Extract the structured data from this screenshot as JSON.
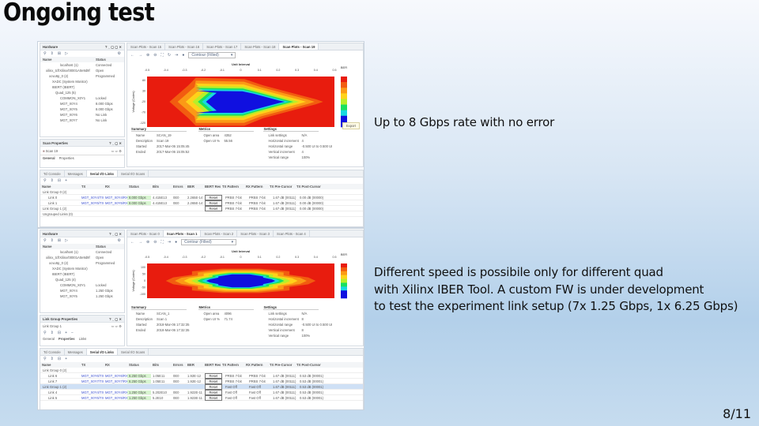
{
  "slide": {
    "title": "Ongoing test",
    "note1": "Up to 8 Gbps rate with no error",
    "note2_lines": [
      "Different speed is possibile only for different quad",
      "with Xilinx IBER Tool. A custom FW is under development",
      "to test the experiment link setup (7x 1.25 Gbps, 1x 6.25 Gbps)"
    ],
    "page": "8/11"
  },
  "shot1": {
    "hardware": {
      "title": "Hardware",
      "cols": [
        "Name",
        "Status"
      ],
      "rows": [
        {
          "name": "localhost (1)",
          "status": "Connected"
        },
        {
          "name": "xilinx_tcf/Xilinx/00001A0e9d9f",
          "status": "Open"
        },
        {
          "name": "xcvu9p_0 (2)",
          "status": "Programmed"
        },
        {
          "name": "XADC (System Monitor)",
          "status": ""
        },
        {
          "name": "IBERT (IBERT)",
          "status": ""
        },
        {
          "name": "Quad_125 (5)",
          "status": ""
        },
        {
          "name": "COMMON_X0Y1",
          "status": "Locked"
        },
        {
          "name": "MGT_X0Y4",
          "status": "8.000 Gbps"
        },
        {
          "name": "MGT_X0Y5",
          "status": "8.000 Gbps"
        },
        {
          "name": "MGT_X0Y6",
          "status": "No Link"
        },
        {
          "name": "MGT_X0Y7",
          "status": "No Link"
        }
      ]
    },
    "scan_props": {
      "title": "Scan Properties",
      "item": "Scan 19",
      "tabs": [
        "General",
        "Properties"
      ]
    },
    "plot_tabs": [
      "Scan Plots - Scan 15",
      "Scan Plots - Scan 16",
      "Scan Plots - Scan 17",
      "Scan Plots - Scan 18",
      "Scan Plots - Scan 19"
    ],
    "plot_mode": "Contour (Filled)",
    "plot": {
      "xlabel": "Unit Interval",
      "ylabel": "Voltage (Codes)",
      "legend": "BER",
      "xticks": [
        "-0.5",
        "-0.4",
        "-0.3",
        "-0.2",
        "-0.1",
        "0",
        "0.1",
        "0.2",
        "0.3",
        "0.4",
        "0.5"
      ],
      "yticks": [
        "80",
        "30",
        "-20",
        "-70",
        "-120"
      ]
    },
    "summary": {
      "title": "Summary",
      "rows": [
        [
          "Name",
          "SCAN_19"
        ],
        [
          "Description",
          "Scan 19"
        ],
        [
          "Started",
          "2017-Mar-06 15:05:45"
        ],
        [
          "Ended",
          "2017-Mar-06 15:05:52"
        ]
      ]
    },
    "metrics": {
      "title": "Metrics",
      "rows": [
        [
          "Open area",
          "4352"
        ],
        [
          "Open UI %",
          "55.56"
        ]
      ]
    },
    "settings": {
      "title": "Settings",
      "rows": [
        [
          "Link settings",
          "N/A"
        ],
        [
          "Horizontal increment",
          "4"
        ],
        [
          "Horizontal range",
          "-0.500 UI to 0.500 UI"
        ],
        [
          "Vertical increment",
          "4"
        ],
        [
          "Vertical range",
          "100%"
        ]
      ]
    },
    "export_label": "Export",
    "bottom_tabs": [
      "Tcl Console",
      "Messages",
      "Serial I/O Links",
      "Serial I/O Scans"
    ],
    "links": {
      "cols": [
        "Name",
        "TX",
        "RX",
        "Status",
        "Bits",
        "Errors",
        "BER",
        "BERT Reset",
        "TX Pattern",
        "RX Pattern",
        "TX Pre-Cursor",
        "TX Post-Cursor"
      ],
      "rows": [
        {
          "name": "Link Group 0 (2)",
          "group": true
        },
        {
          "name": "Link 0",
          "tx": "MGT_X0Y4/TX",
          "rx": "MGT_X0Y4/RX",
          "status": "8.000 Gbps",
          "bits": "4.415E13",
          "errors": "0E0",
          "ber": "2.265E-14",
          "reset": "Reset",
          "txp": "PRBS 7-bit",
          "rxp": "PRBS 7-bit",
          "pre": "1.67 dB (00111)",
          "post": "0.00 dB (00000)"
        },
        {
          "name": "Link 1",
          "tx": "MGT_X0Y5/TX",
          "rx": "MGT_X0Y5/RX",
          "status": "8.000 Gbps",
          "bits": "4.415E13",
          "errors": "0E0",
          "ber": "2.265E-14",
          "reset": "Reset",
          "txp": "PRBS 7-bit",
          "rxp": "PRBS 7-bit",
          "pre": "1.67 dB (00111)",
          "post": "0.00 dB (00000)"
        },
        {
          "name": "Link Group 1 (2)",
          "group": true,
          "reset": "Reset",
          "txp": "PRBS 7-bit",
          "rxp": "PRBS 7-bit",
          "pre": "1.67 dB (00111)",
          "post": "0.00 dB (00000)"
        },
        {
          "name": "Ungrouped Links (0)",
          "group": true
        }
      ]
    }
  },
  "shot2": {
    "hardware": {
      "title": "Hardware",
      "cols": [
        "Name",
        "Status"
      ],
      "rows": [
        {
          "name": "localhost (1)",
          "status": "Connected"
        },
        {
          "name": "xilinx_tcf/Xilinx/00001A0e9d9f",
          "status": "Open"
        },
        {
          "name": "xcvu9p_0 (2)",
          "status": "Programmed"
        },
        {
          "name": "XADC (System Monitor)",
          "status": ""
        },
        {
          "name": "IBERT (IBERT)",
          "status": ""
        },
        {
          "name": "Quad_125 (4)",
          "status": ""
        },
        {
          "name": "COMMON_X0Y1",
          "status": "Locked"
        },
        {
          "name": "MGT_X0Y4",
          "status": "1.250 Gbps"
        },
        {
          "name": "MGT_X0Y5",
          "status": "1.250 Gbps"
        }
      ]
    },
    "group_props": {
      "title": "Link Group Properties",
      "item": "Link Group 1",
      "tabs": [
        "General",
        "Properties",
        "Links"
      ]
    },
    "plot_tabs": [
      "Scan Plots - Scan 0",
      "Scan Plots - Scan 1",
      "Scan Plots - Scan 2",
      "Scan Plots - Scan 3",
      "Scan Plots - Scan 4"
    ],
    "plot_mode": "Contour (Filled)",
    "plot": {
      "xlabel": "Unit Interval",
      "ylabel": "Voltage (Codes)",
      "legend": "BER",
      "xticks": [
        "-0.5",
        "-0.4",
        "-0.3",
        "-0.2",
        "-0.1",
        "0",
        "0.1",
        "0.2",
        "0.3",
        "0.4",
        "0.5"
      ],
      "yticks": [
        "100",
        "50",
        "0",
        "-50",
        "-100"
      ]
    },
    "summary": {
      "title": "Summary",
      "rows": [
        [
          "Name",
          "SCAN_1"
        ],
        [
          "Description",
          "Scan 1"
        ],
        [
          "Started",
          "2018-Mar-06 17:32:35"
        ],
        [
          "Ended",
          "2018-Mar-06 17:32:35"
        ]
      ]
    },
    "metrics": {
      "title": "Metrics",
      "rows": [
        [
          "Open area",
          "4096"
        ],
        [
          "Open UI %",
          "71.74"
        ]
      ]
    },
    "settings": {
      "title": "Settings",
      "rows": [
        [
          "Link settings",
          "N/A"
        ],
        [
          "Horizontal increment",
          "8"
        ],
        [
          "Horizontal range",
          "-0.500 UI to 0.500 UI"
        ],
        [
          "Vertical increment",
          "8"
        ],
        [
          "Vertical range",
          "100%"
        ]
      ]
    },
    "bottom_tabs": [
      "Tcl Console",
      "Messages",
      "Serial I/O Links",
      "Serial I/O Scans"
    ],
    "links": {
      "cols": [
        "Name",
        "TX",
        "RX",
        "Status",
        "Bits",
        "Errors",
        "BER",
        "BERT Reset",
        "TX Pattern",
        "RX Pattern",
        "TX Pre-Cursor",
        "TX Post-Cursor"
      ],
      "rows": [
        {
          "name": "Link Group 0 (2)",
          "group": true
        },
        {
          "name": "Link 6",
          "tx": "MGT_X0Y6/TX",
          "rx": "MGT_X0Y6/RX",
          "status": "6.250 Gbps",
          "bits": "1.05E11",
          "errors": "0E0",
          "ber": "1.92E-12",
          "reset": "Reset",
          "txp": "PRBS 7-bit",
          "rxp": "PRBS 7-bit",
          "pre": "1.67 dB (00111)",
          "post": "0.53 dB (00001)"
        },
        {
          "name": "Link 7",
          "tx": "MGT_X0Y7/TX",
          "rx": "MGT_X0Y7/RX",
          "status": "6.250 Gbps",
          "bits": "1.05E11",
          "errors": "0E0",
          "ber": "1.92E-12",
          "reset": "Reset",
          "txp": "PRBS 7-bit",
          "rxp": "PRBS 7-bit",
          "pre": "1.67 dB (00111)",
          "post": "0.53 dB (00001)"
        },
        {
          "name": "Link Group 1 (2)",
          "group": true,
          "selected": true,
          "reset": "Reset",
          "txp": "Fast Off",
          "rxp": "Fast Off",
          "pre": "1.67 dB (00111)",
          "post": "0.53 dB (00001)"
        },
        {
          "name": "Link 4",
          "tx": "MGT_X0Y4/TX",
          "rx": "MGT_X0Y4/RX",
          "status": "1.250 Gbps",
          "bits": "5.202E10",
          "errors": "0E0",
          "ber": "1.922E-11",
          "reset": "Reset",
          "txp": "Fast Off",
          "rxp": "Fast Off",
          "pre": "1.67 dB (00111)",
          "post": "0.53 dB (00001)"
        },
        {
          "name": "Link 5",
          "tx": "MGT_X0Y5/TX",
          "rx": "MGT_X0Y5/RX",
          "status": "1.250 Gbps",
          "bits": "5.2E10",
          "errors": "0E0",
          "ber": "1.923E-11",
          "reset": "Reset",
          "txp": "Fast Off",
          "rxp": "Fast Off",
          "pre": "1.67 dB (00111)",
          "post": "0.53 dB (00001)"
        }
      ]
    }
  }
}
